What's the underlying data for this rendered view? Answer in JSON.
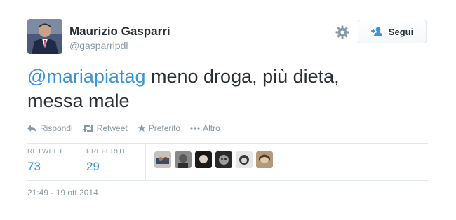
{
  "author": {
    "name": "Maurizio Gasparri",
    "handle": "@gasparripdl"
  },
  "follow_button": {
    "label": "Segui"
  },
  "tweet": {
    "mention": "@mariapiatag",
    "text_line1": " meno droga, più dieta,",
    "text_line2": "messa male"
  },
  "actions": [
    {
      "label": "Rispondi",
      "icon": "reply-icon"
    },
    {
      "label": "Retweet",
      "icon": "retweet-icon"
    },
    {
      "label": "Preferito",
      "icon": "star-icon"
    },
    {
      "label": "Altro",
      "icon": "more-icon"
    }
  ],
  "stats": {
    "retweets_label": "RETWEET",
    "retweets_value": "73",
    "favorites_label": "PREFERITI",
    "favorites_value": "29"
  },
  "timestamp": "21:49 - 19 ott 2014",
  "colors": {
    "link": "#3b94d9",
    "text": "#292f33",
    "muted": "#8899a6",
    "border": "#e1e8ed"
  }
}
